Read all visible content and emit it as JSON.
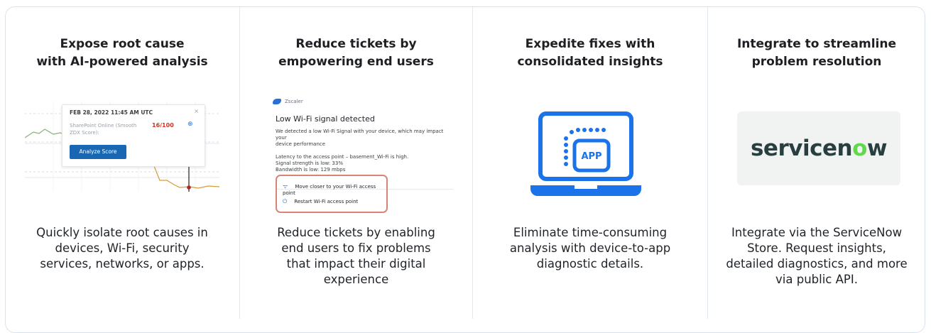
{
  "columns": [
    {
      "title": "Expose root cause\nwith AI-powered analysis",
      "description": "Quickly isolate root causes in\ndevices, Wi-Fi, security\nservices, networks, or apps.",
      "screenshot": {
        "date": "FEB 28, 2022 11:45 AM UTC",
        "close_glyph": "×",
        "label": "SharePoint Online (Smooth ZDX Score):",
        "score": "16/100",
        "button": "Analyze Score"
      }
    },
    {
      "title": "Reduce tickets by\nempowering end users",
      "description": "Reduce tickets by enabling\nend users to fix problems\nthat impact their digital\nexperience",
      "screenshot": {
        "brand": "Zscaler",
        "heading": "Low Wi-Fi signal detected",
        "body": "We detected a low Wi-Fi Signal with your device, which may impact your\ndevice performance\n\nLatency to the access point – basement_Wi-Fi is high.\nSignal strength is low: 33%\nBandwidth is low: 129 mbps",
        "actions": [
          "Move closer to your Wi-Fi access point",
          "Restart Wi-Fi access point"
        ]
      }
    },
    {
      "title": "Expedite fixes with\nconsolidated insights",
      "description": "Eliminate time-consuming\nanalysis with device-to-app\ndiagnostic details.",
      "icon": {
        "name": "laptop-app-icon",
        "label": "APP",
        "color": "#1a73e8"
      }
    },
    {
      "title": "Integrate to streamline\nproblem resolution",
      "description": "Integrate via the ServiceNow\nStore. Request insights,\ndetailed diagnostics, and more\nvia public API.",
      "logo": {
        "text_before": "servicen",
        "text_o": "o",
        "text_after": "w",
        "color": "#293e40",
        "accent": "#62d84e"
      }
    }
  ],
  "colors": {
    "border": "#d9e3ef",
    "accent": "#1a73e8",
    "button": "#1967b2",
    "alert": "#d93025",
    "highlight_box": "#d98474"
  }
}
